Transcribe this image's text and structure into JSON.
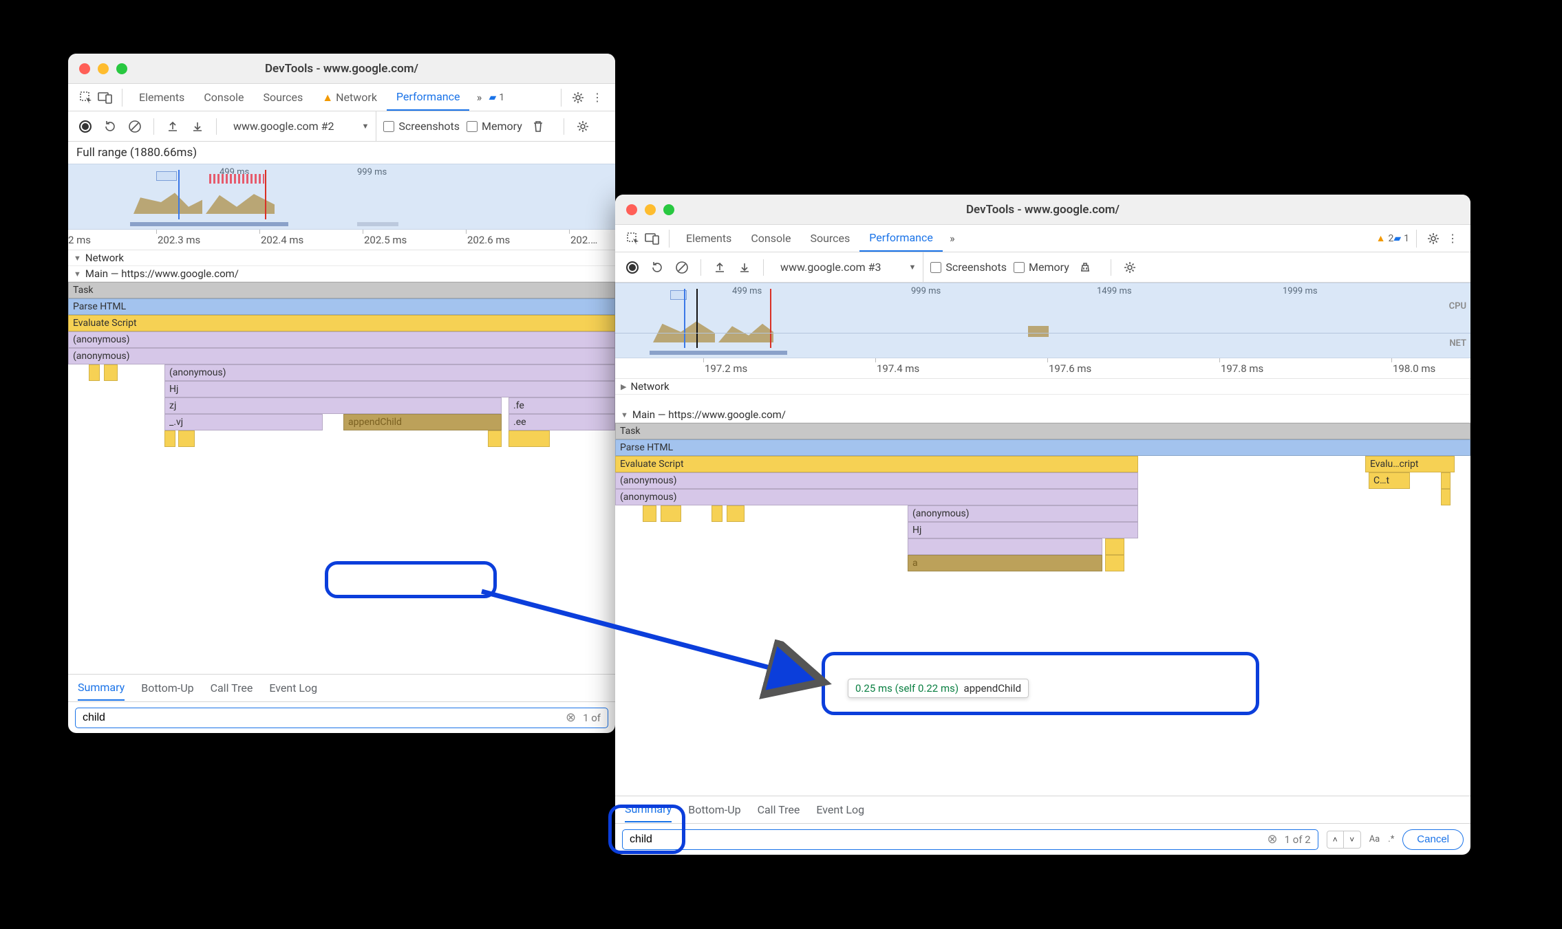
{
  "win1": {
    "title": "DevTools - www.google.com/",
    "tabs": [
      "Elements",
      "Console",
      "Sources",
      "Network",
      "Performance"
    ],
    "active_tab": "Performance",
    "issues_count": "1",
    "toolbar": {
      "dropdown": "www.google.com #2",
      "screenshots": "Screenshots",
      "memory": "Memory"
    },
    "fullrange": "Full range (1880.66ms)",
    "overview_ticks": [
      "499 ms",
      "999 ms"
    ],
    "ruler": [
      "2 ms",
      "202.3 ms",
      "202.4 ms",
      "202.5 ms",
      "202.6 ms",
      "202.…"
    ],
    "network_label": "Network",
    "main_label": "Main — https://www.google.com/",
    "stack": {
      "task": "Task",
      "parse": "Parse HTML",
      "eval": "Evaluate Script",
      "anon": "(anonymous)",
      "hj": "Hj",
      "zj": "zj",
      "vj": "_.vj",
      "append": "appendChild",
      "fe": ".fe",
      "ee": ".ee"
    },
    "btabs": [
      "Summary",
      "Bottom-Up",
      "Call Tree",
      "Event Log"
    ],
    "search_value": "child",
    "search_count": "1 of"
  },
  "win2": {
    "title": "DevTools - www.google.com/",
    "tabs": [
      "Elements",
      "Console",
      "Sources",
      "Performance"
    ],
    "active_tab": "Performance",
    "warn_count": "2",
    "issues_count": "1",
    "toolbar": {
      "dropdown": "www.google.com #3",
      "screenshots": "Screenshots",
      "memory": "Memory"
    },
    "overview_ticks": [
      "499 ms",
      "999 ms",
      "1499 ms",
      "1999 ms"
    ],
    "ov_labels": {
      "cpu": "CPU",
      "net": "NET"
    },
    "ruler": [
      "197.2 ms",
      "197.4 ms",
      "197.6 ms",
      "197.8 ms",
      "198.0 ms"
    ],
    "network_label": "Network",
    "main_label": "Main — https://www.google.com/",
    "stack": {
      "task": "Task",
      "parse": "Parse HTML",
      "eval": "Evaluate Script",
      "eval2": "Evalu…cript",
      "ct": "C…t",
      "anon": "(anonymous)",
      "hj": "Hj",
      "a": "a"
    },
    "tooltip": {
      "time": "0.25 ms (self 0.22 ms)",
      "name": "appendChild"
    },
    "btabs": [
      "Summary",
      "Bottom-Up",
      "Call Tree",
      "Event Log"
    ],
    "search_value": "child",
    "search_count": "1 of 2",
    "aa": "Aa",
    "regex": ".*",
    "cancel": "Cancel"
  }
}
